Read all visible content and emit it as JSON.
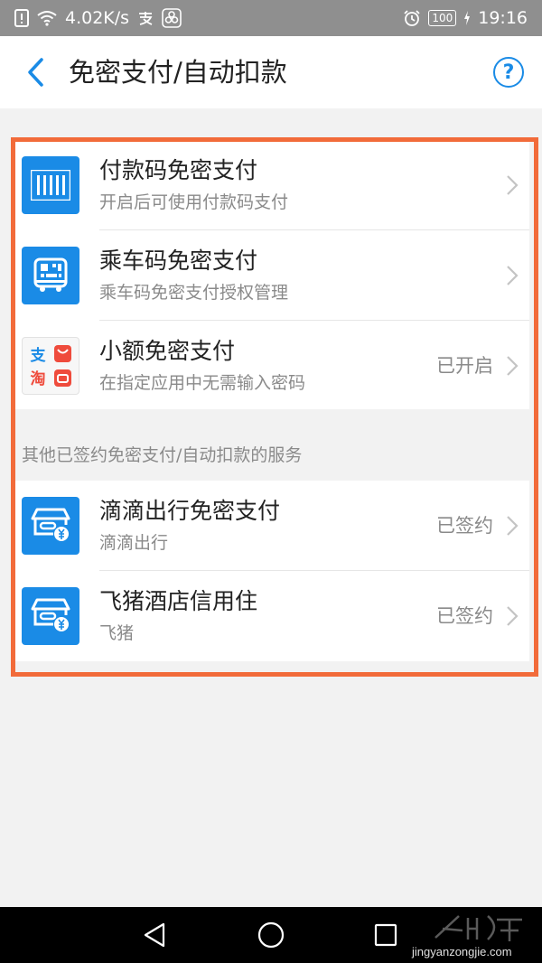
{
  "status_bar": {
    "speed": "4.02K/s",
    "battery": "100",
    "time": "19:16"
  },
  "header": {
    "title": "免密支付/自动扣款",
    "help": "?"
  },
  "section1": {
    "rows": [
      {
        "title": "付款码免密支付",
        "subtitle": "开启后可使用付款码支付",
        "status": "",
        "icon": "barcode-icon"
      },
      {
        "title": "乘车码免密支付",
        "subtitle": "乘车码免密支付授权管理",
        "status": "",
        "icon": "bus-qr-icon"
      },
      {
        "title": "小额免密支付",
        "subtitle": "在指定应用中无需输入密码",
        "status": "已开启",
        "icon": "alipay-taobao-icon"
      }
    ]
  },
  "section_label": "其他已签约免密支付/自动扣款的服务",
  "section2": {
    "rows": [
      {
        "title": "滴滴出行免密支付",
        "subtitle": "滴滴出行",
        "status": "已签约",
        "icon": "store-yen-icon"
      },
      {
        "title": "飞猪酒店信用住",
        "subtitle": "飞猪",
        "status": "已签约",
        "icon": "store-yen-icon"
      }
    ]
  },
  "icon_texts": {
    "alipay_zhi": "支",
    "taobao_tao": "淘"
  },
  "watermark": {
    "url": "jingyanzongjie.com"
  },
  "colors": {
    "accent": "#1a8be6",
    "highlight_border": "#f26b3a",
    "status_bar": "#8f8f8f",
    "background": "#f2f2f2"
  }
}
